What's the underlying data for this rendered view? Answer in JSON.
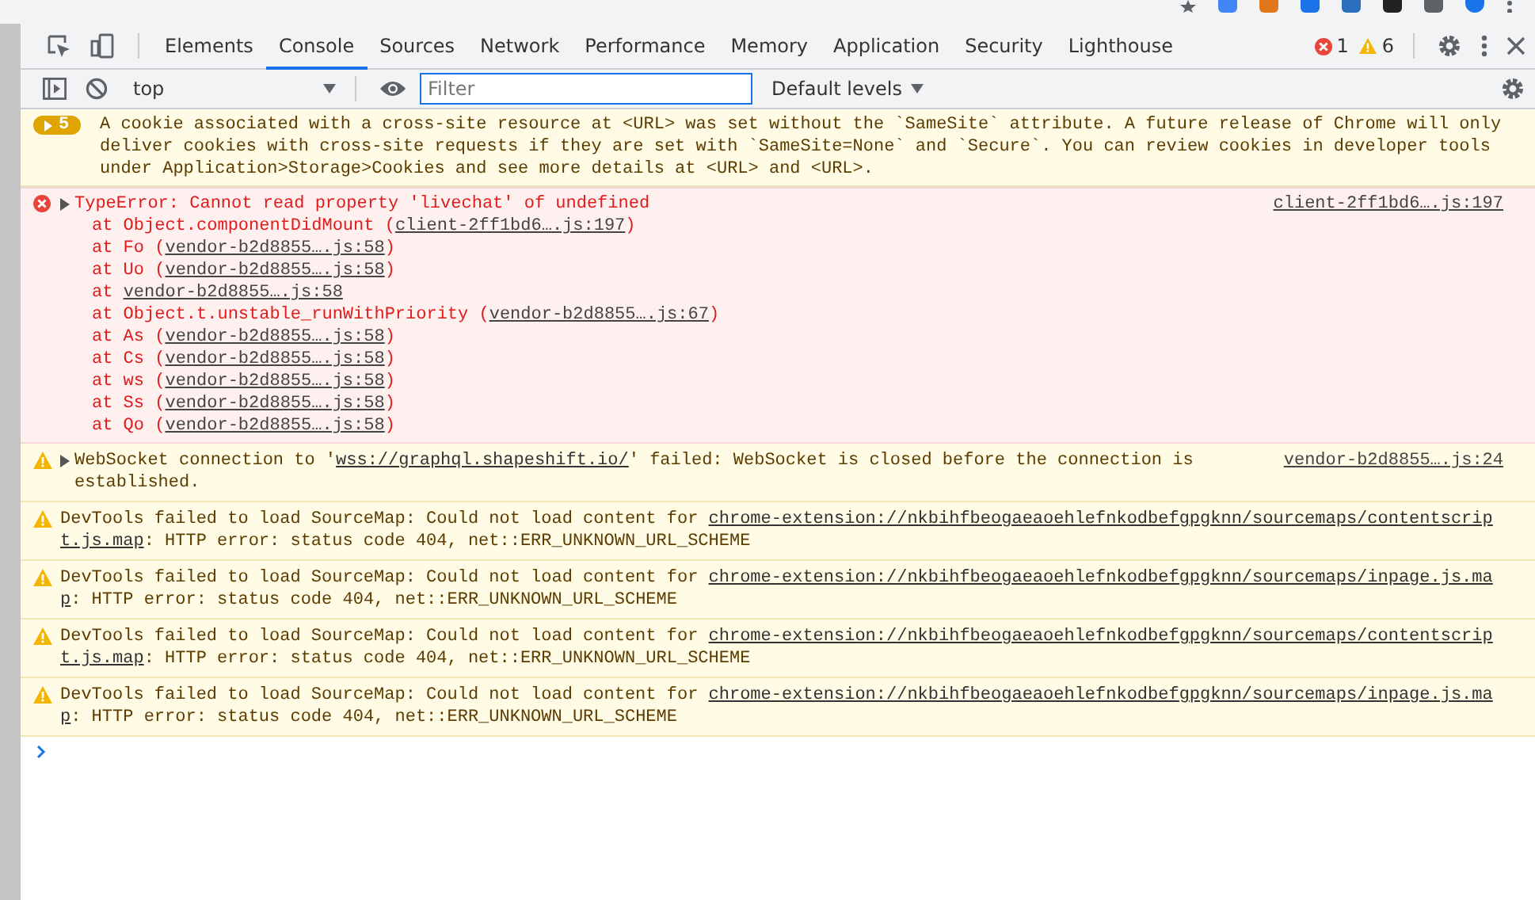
{
  "tabs": [
    {
      "label": "Elements",
      "selected": false
    },
    {
      "label": "Console",
      "selected": true
    },
    {
      "label": "Sources",
      "selected": false
    },
    {
      "label": "Network",
      "selected": false
    },
    {
      "label": "Performance",
      "selected": false
    },
    {
      "label": "Memory",
      "selected": false
    },
    {
      "label": "Application",
      "selected": false
    },
    {
      "label": "Security",
      "selected": false
    },
    {
      "label": "Lighthouse",
      "selected": false
    }
  ],
  "error_count": "1",
  "warning_count": "6",
  "toolbar": {
    "context": "top",
    "filter": {
      "placeholder": "Filter"
    },
    "levels": "Default levels"
  },
  "messages": [
    {
      "kind": "issue",
      "badge": "5",
      "lines": [
        [
          {
            "kind": "text",
            "text": "A cookie associated with a cross-site resource at <URL> was set without the `SameSite` attribute. A future release of Chrome will only"
          }
        ],
        [
          {
            "kind": "text",
            "text": "deliver cookies with cross-site requests if they are set with `SameSite=None` and `Secure`. You can review cookies in developer tools"
          }
        ],
        [
          {
            "kind": "text",
            "text": "under Application>Storage>Cookies and see more details at <URL> and <URL>."
          }
        ]
      ]
    },
    {
      "kind": "error",
      "expandable": true,
      "lines": [
        [
          {
            "kind": "text",
            "text": "TypeError: Cannot read property 'livechat' of undefined"
          }
        ]
      ],
      "source": "client-2ff1bd6….js:197",
      "stack": [
        {
          "before": "at Object.componentDidMount (",
          "link": "client-2ff1bd6….js:197",
          "after": ")"
        },
        {
          "before": "at Fo (",
          "link": "vendor-b2d8855….js:58",
          "after": ")"
        },
        {
          "before": "at Uo (",
          "link": "vendor-b2d8855….js:58",
          "after": ")"
        },
        {
          "before": "at ",
          "link": "vendor-b2d8855….js:58"
        },
        {
          "before": "at Object.t.unstable_runWithPriority (",
          "link": "vendor-b2d8855….js:67",
          "after": ")"
        },
        {
          "before": "at As (",
          "link": "vendor-b2d8855….js:58",
          "after": ")"
        },
        {
          "before": "at Cs (",
          "link": "vendor-b2d8855….js:58",
          "after": ")"
        },
        {
          "before": "at ws (",
          "link": "vendor-b2d8855….js:58",
          "after": ")"
        },
        {
          "before": "at Ss (",
          "link": "vendor-b2d8855….js:58",
          "after": ")"
        },
        {
          "before": "at Qo (",
          "link": "vendor-b2d8855….js:58",
          "after": ")"
        }
      ]
    },
    {
      "kind": "warning",
      "expandable": true,
      "lines": [
        [
          {
            "kind": "text",
            "text": "WebSocket connection to '"
          },
          {
            "kind": "link",
            "text": "wss://graphql.shapeshift.io/"
          },
          {
            "kind": "text",
            "text": "' failed: WebSocket is closed before the connection is"
          }
        ],
        [
          {
            "kind": "text",
            "text": "established."
          }
        ]
      ],
      "source": "vendor-b2d8855….js:24"
    },
    {
      "kind": "warning",
      "expandable": false,
      "lines": [
        [
          {
            "kind": "text",
            "text": "DevTools failed to load SourceMap: Could not load content for "
          },
          {
            "kind": "link",
            "text": "chrome-extension://nkbihfbeogaeaoehlefnkodbefgpgknn/sourcemaps/contentscrip"
          }
        ],
        [
          {
            "kind": "link",
            "text": "t.js.map"
          },
          {
            "kind": "text",
            "text": ": HTTP error: status code 404, net::ERR_UNKNOWN_URL_SCHEME"
          }
        ]
      ]
    },
    {
      "kind": "warning",
      "expandable": false,
      "lines": [
        [
          {
            "kind": "text",
            "text": "DevTools failed to load SourceMap: Could not load content for "
          },
          {
            "kind": "link",
            "text": "chrome-extension://nkbihfbeogaeaoehlefnkodbefgpgknn/sourcemaps/inpage.js.ma"
          }
        ],
        [
          {
            "kind": "link",
            "text": "p"
          },
          {
            "kind": "text",
            "text": ": HTTP error: status code 404, net::ERR_UNKNOWN_URL_SCHEME"
          }
        ]
      ]
    },
    {
      "kind": "warning",
      "expandable": false,
      "lines": [
        [
          {
            "kind": "text",
            "text": "DevTools failed to load SourceMap: Could not load content for "
          },
          {
            "kind": "link",
            "text": "chrome-extension://nkbihfbeogaeaoehlefnkodbefgpgknn/sourcemaps/contentscrip"
          }
        ],
        [
          {
            "kind": "link",
            "text": "t.js.map"
          },
          {
            "kind": "text",
            "text": ": HTTP error: status code 404, net::ERR_UNKNOWN_URL_SCHEME"
          }
        ]
      ]
    },
    {
      "kind": "warning",
      "expandable": false,
      "lines": [
        [
          {
            "kind": "text",
            "text": "DevTools failed to load SourceMap: Could not load content for "
          },
          {
            "kind": "link",
            "text": "chrome-extension://nkbihfbeogaeaoehlefnkodbefgpgknn/sourcemaps/inpage.js.ma"
          }
        ],
        [
          {
            "kind": "link",
            "text": "p"
          },
          {
            "kind": "text",
            "text": ": HTTP error: status code 404, net::ERR_UNKNOWN_URL_SCHEME"
          }
        ]
      ]
    }
  ]
}
